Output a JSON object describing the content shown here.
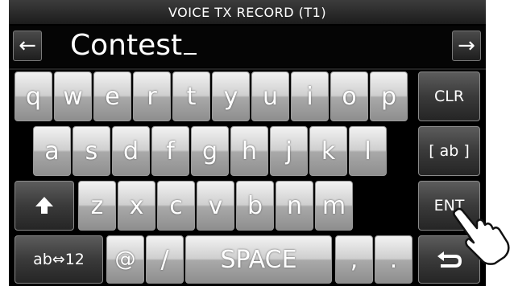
{
  "title": "VOICE TX RECORD  (T1)",
  "entry_text": "Contest",
  "nav": {
    "left_arrow": "←",
    "right_arrow": "→"
  },
  "keys": {
    "row1": [
      "q",
      "w",
      "e",
      "r",
      "t",
      "y",
      "u",
      "i",
      "o",
      "p"
    ],
    "row2": [
      "a",
      "s",
      "d",
      "f",
      "g",
      "h",
      "j",
      "k",
      "l"
    ],
    "row3": [
      "z",
      "x",
      "c",
      "v",
      "b",
      "n",
      "m"
    ],
    "clr": "CLR",
    "ab": "[ ab ]",
    "ent": "ENT",
    "mode": "ab⇔12",
    "at": "@",
    "slash": "/",
    "space": "SPACE",
    "comma": ",",
    "period": ".",
    "shift_icon": "up-arrow-icon",
    "back_icon": "return-arrow-icon"
  }
}
